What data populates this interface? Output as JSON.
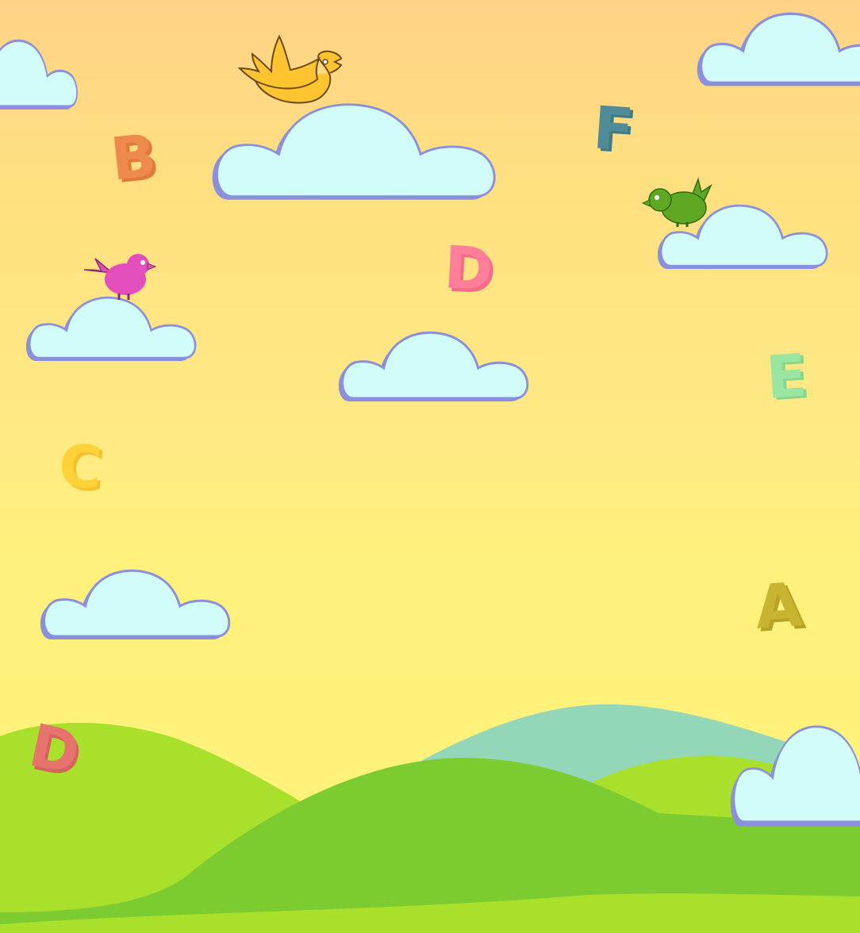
{
  "scene": {
    "colors": {
      "sky_top": "#ffd386",
      "sky_bottom": "#fff27a",
      "cloud_fill": "#d2fcfa",
      "cloud_shadow": "#8c8fdb",
      "hill_light": "#a8e02c",
      "hill_mid": "#7ccc31",
      "hill_teal": "#93d7b8"
    }
  },
  "letters": {
    "b": "B",
    "f": "F",
    "d_top": "D",
    "e": "E",
    "c": "C",
    "a": "A",
    "d_bottom": "D"
  },
  "birds": [
    {
      "name": "yellow-bird",
      "color": "#ffc430",
      "state": "flying"
    },
    {
      "name": "pink-bird",
      "color": "#e24fbc",
      "state": "perched"
    },
    {
      "name": "green-bird",
      "color": "#5fa824",
      "state": "perched"
    }
  ]
}
